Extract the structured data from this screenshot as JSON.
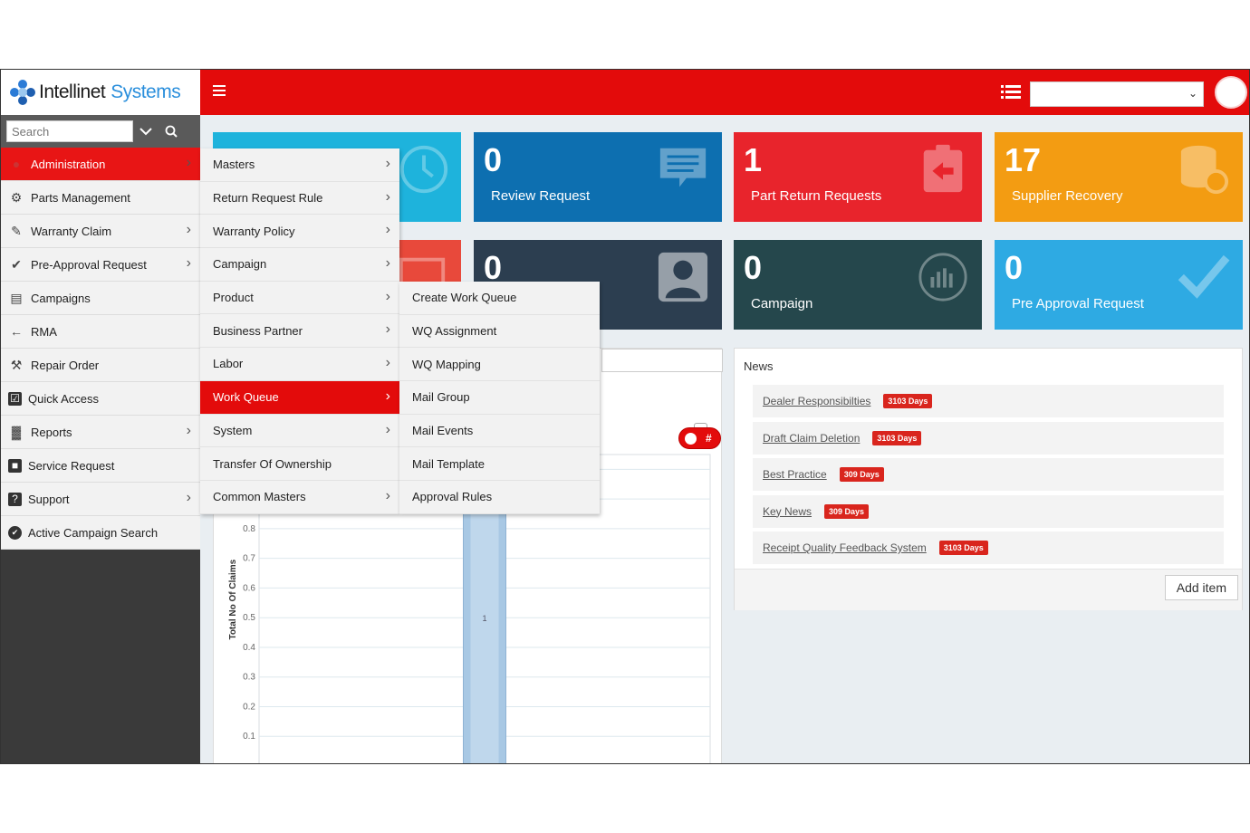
{
  "brand": {
    "name_part1": "Intellinet",
    "name_part2": "Systems"
  },
  "search": {
    "placeholder": "Search"
  },
  "sidebar": {
    "items": [
      {
        "label": "Administration",
        "icon": "user-icon",
        "has_submenu": true,
        "active": true
      },
      {
        "label": "Parts Management",
        "icon": "gear-icon",
        "has_submenu": false
      },
      {
        "label": "Warranty Claim",
        "icon": "edit-icon",
        "has_submenu": true
      },
      {
        "label": "Pre-Approval Request",
        "icon": "check-icon",
        "has_submenu": true
      },
      {
        "label": "Campaigns",
        "icon": "list-icon",
        "has_submenu": false
      },
      {
        "label": "RMA",
        "icon": "arrow-left-icon",
        "has_submenu": false
      },
      {
        "label": "Repair Order",
        "icon": "wrench-icon",
        "has_submenu": false
      },
      {
        "label": "Quick Access",
        "icon": "checkbox-icon",
        "has_submenu": false
      },
      {
        "label": "Reports",
        "icon": "bar-chart-icon",
        "has_submenu": true
      },
      {
        "label": "Service Request",
        "icon": "person-badge-icon",
        "has_submenu": false
      },
      {
        "label": "Support",
        "icon": "question-icon",
        "has_submenu": true
      },
      {
        "label": "Active Campaign Search",
        "icon": "check-circle-icon",
        "has_submenu": false
      }
    ]
  },
  "admin_menu": {
    "items": [
      {
        "label": "Masters",
        "has_submenu": true
      },
      {
        "label": "Return Request Rule",
        "has_submenu": true
      },
      {
        "label": "Warranty Policy",
        "has_submenu": true
      },
      {
        "label": "Campaign",
        "has_submenu": true
      },
      {
        "label": "Product",
        "has_submenu": true
      },
      {
        "label": "Business Partner",
        "has_submenu": true
      },
      {
        "label": "Labor",
        "has_submenu": true
      },
      {
        "label": "Work Queue",
        "has_submenu": true,
        "active": true
      },
      {
        "label": "System",
        "has_submenu": true
      },
      {
        "label": "Transfer Of Ownership",
        "has_submenu": false
      },
      {
        "label": "Common Masters",
        "has_submenu": true
      }
    ]
  },
  "work_queue_menu": {
    "items": [
      {
        "label": "Create Work Queue"
      },
      {
        "label": "WQ Assignment"
      },
      {
        "label": "WQ Mapping"
      },
      {
        "label": "Mail Group"
      },
      {
        "label": "Mail Events"
      },
      {
        "label": "Mail Template"
      },
      {
        "label": "Approval Rules"
      }
    ]
  },
  "cards_row1": [
    {
      "value": "0",
      "label": "Review Request",
      "color": "#0d6fb0",
      "icon": "message-icon"
    },
    {
      "value": "1",
      "label": "Part Return Requests",
      "color": "#e8242c",
      "icon": "clipboard-return-icon"
    },
    {
      "value": "17",
      "label": "Supplier Recovery",
      "color": "#f39c12",
      "icon": "database-refresh-icon"
    }
  ],
  "card_left1": {
    "color": "#1eb3dc",
    "icon": "clock-icon"
  },
  "card_left2": {
    "color": "#e8493b",
    "icon": "screen-icon"
  },
  "cards_row2": [
    {
      "value": "0",
      "label": "",
      "color": "#2c3e50",
      "icon": "person-icon"
    },
    {
      "value": "0",
      "label": "Campaign",
      "color": "#25474c",
      "icon": "chart-circle-icon"
    },
    {
      "value": "0",
      "label": "Pre Approval Request",
      "color": "#2eaae3",
      "icon": "checkmark-icon"
    }
  ],
  "toggle": {
    "label": "#"
  },
  "news": {
    "title": "News",
    "items": [
      {
        "title": "Dealer Responsibilties",
        "age": "3103 Days"
      },
      {
        "title": "Draft Claim Deletion",
        "age": "3103 Days"
      },
      {
        "title": "Best Practice",
        "age": "309 Days"
      },
      {
        "title": "Key News",
        "age": "309 Days"
      },
      {
        "title": "Receipt Quality Feedback System",
        "age": "3103 Days"
      }
    ],
    "add_label": "Add item"
  },
  "chart_data": {
    "type": "bar",
    "title": "",
    "ylabel": "Total No Of Claims",
    "xlabel": "",
    "y_ticks": [
      "0.1",
      "0.2",
      "0.3",
      "0.4",
      "0.5",
      "0.6",
      "0.7",
      "0.8"
    ],
    "ylim": [
      0,
      1.05
    ],
    "grid": true,
    "categories": [
      ""
    ],
    "values": [
      1
    ],
    "data_labels": [
      "1"
    ],
    "bar_color": "#a8c8e4"
  }
}
